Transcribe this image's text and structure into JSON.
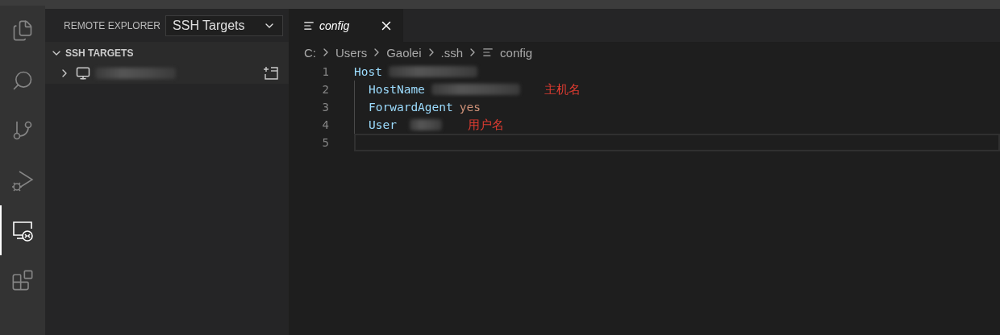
{
  "activity_bar": [
    {
      "kind": "explorer",
      "selected": false
    },
    {
      "kind": "search",
      "selected": false
    },
    {
      "kind": "source-control",
      "selected": false
    },
    {
      "kind": "run-debug",
      "selected": false
    },
    {
      "kind": "remote",
      "selected": true
    },
    {
      "kind": "extensions",
      "selected": false
    }
  ],
  "sidebar": {
    "title": "REMOTE EXPLORER",
    "dropdown": {
      "value": "SSH Targets"
    },
    "section": {
      "title": "SSH TARGETS",
      "expanded": true,
      "items": [
        {
          "expanded": false,
          "kind": "host"
        }
      ]
    }
  },
  "tabs": [
    {
      "label": "config",
      "selected": true
    }
  ],
  "breadcrumb": [
    "C:",
    "Users",
    "Gaolei",
    ".ssh",
    "config"
  ],
  "editor": {
    "lines": [
      {
        "number": "1",
        "indent": false,
        "current": false,
        "tokens": [
          {
            "text": "Host",
            "kind": "keyword"
          },
          {
            "kind": "redacted"
          }
        ]
      },
      {
        "number": "2",
        "indent": true,
        "current": false,
        "tokens": [
          {
            "text": "HostName",
            "kind": "keyword"
          },
          {
            "kind": "redacted-long"
          }
        ],
        "note": "主机名"
      },
      {
        "number": "3",
        "indent": true,
        "current": false,
        "tokens": [
          {
            "text": "ForwardAgent",
            "kind": "keyword"
          },
          {
            "text": "yes",
            "kind": "value"
          }
        ]
      },
      {
        "number": "4",
        "indent": true,
        "current": false,
        "tokens": [
          {
            "text": "User",
            "kind": "keyword"
          },
          {
            "kind": "redacted-short"
          }
        ],
        "note": "用户名"
      },
      {
        "number": "5",
        "indent": false,
        "current": true
      }
    ]
  }
}
